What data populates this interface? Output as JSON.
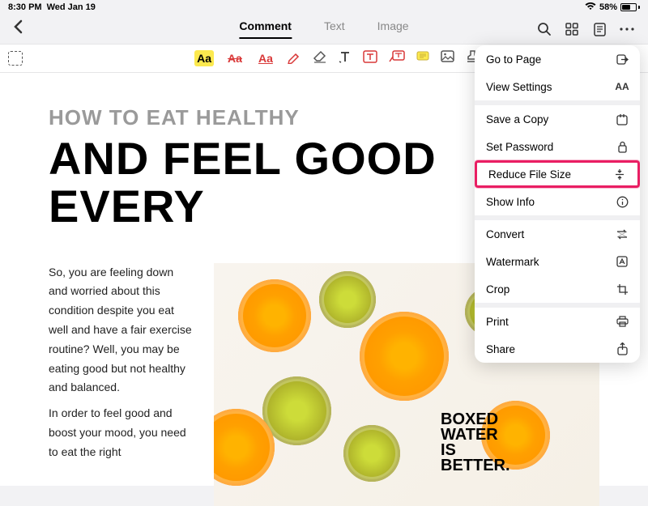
{
  "status": {
    "time": "8:30 PM",
    "date": "Wed Jan 19",
    "battery": "58%"
  },
  "tabs": {
    "comment": "Comment",
    "text": "Text",
    "image": "Image"
  },
  "doc": {
    "subhead": "HOW TO EAT HEALTHY",
    "headline": "AND FEEL GOOD EVERY",
    "p1": "So, you are feeling down and worried about this condition despite you eat well and have a fair exercise routine? Well, you may be eating good but not healthy and balanced.",
    "p2": "In order to feel good and boost your mood, you need to eat the right",
    "box1": "BOXED",
    "box2": "WATER",
    "box3": "IS",
    "box4": "BETTER."
  },
  "menu": {
    "goto": "Go to Page",
    "view": "View Settings",
    "save": "Save a Copy",
    "password": "Set Password",
    "reduce": "Reduce File Size",
    "info": "Show Info",
    "convert": "Convert",
    "watermark": "Watermark",
    "crop": "Crop",
    "print": "Print",
    "share": "Share"
  }
}
